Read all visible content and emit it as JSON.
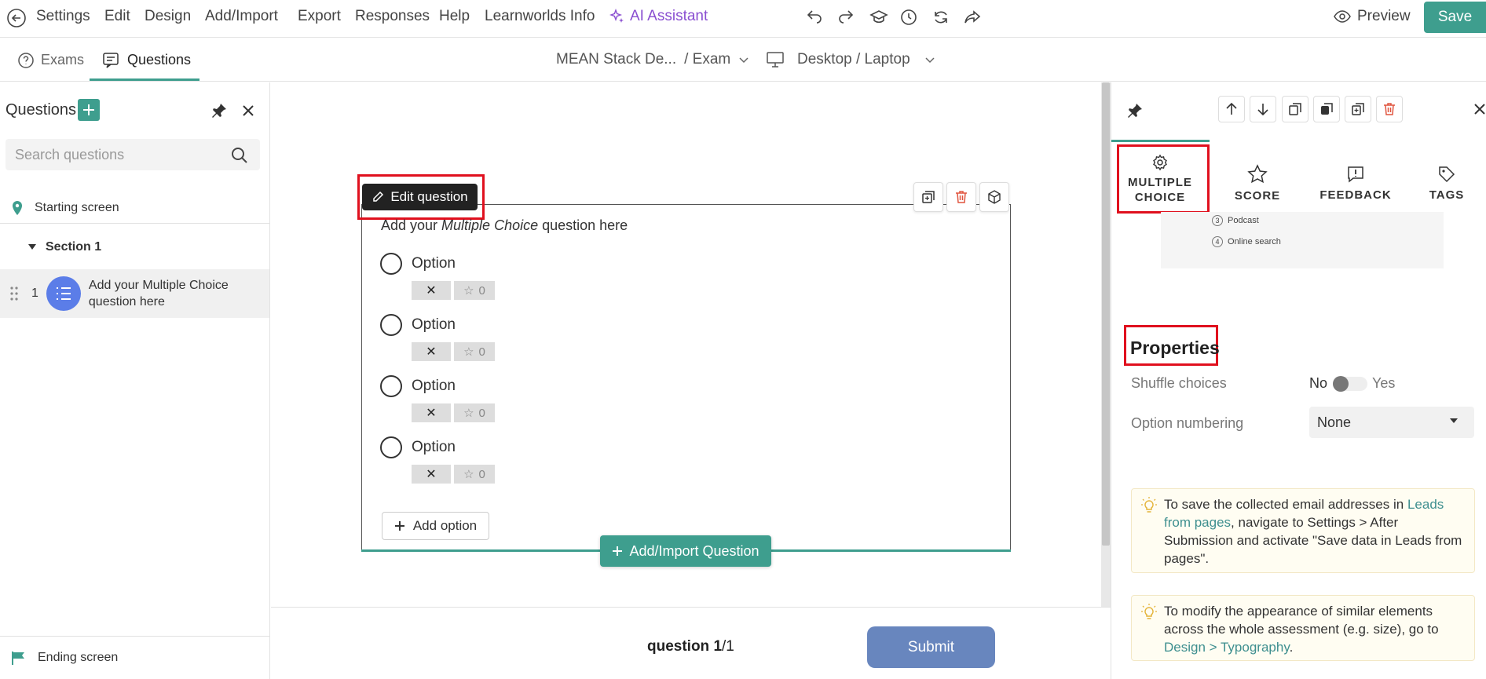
{
  "topbar": {
    "menu": [
      "Settings",
      "Edit",
      "Design",
      "Add/Import",
      "Export",
      "Responses",
      "Help",
      "Learnworlds Info"
    ],
    "ai_assistant": "AI Assistant",
    "preview_label": "Preview",
    "save_label": "Save"
  },
  "subbar": {
    "tab_exams": "Exams",
    "tab_questions": "Questions",
    "course_name": "MEAN Stack De...",
    "course_suffix": "/ Exam",
    "device": "Desktop / Laptop"
  },
  "left_panel": {
    "title": "Questions",
    "search_placeholder": "Search questions",
    "starting_screen": "Starting screen",
    "section": "Section 1",
    "question_number": "1",
    "question_title_line1": "Add your Multiple Choice",
    "question_title_line2": "question here",
    "ending_screen": "Ending screen"
  },
  "canvas": {
    "edit_question_label": "Edit question",
    "prompt_before": "Add your ",
    "prompt_italic": "Multiple Choice",
    "prompt_after": " question here",
    "options": [
      {
        "label": "Option",
        "score": "0"
      },
      {
        "label": "Option",
        "score": "0"
      },
      {
        "label": "Option",
        "score": "0"
      },
      {
        "label": "Option",
        "score": "0"
      }
    ],
    "add_option_label": "Add option",
    "add_import_label": "Add/Import Question"
  },
  "footer": {
    "question_word": "question",
    "current": "1",
    "total": "/1",
    "submit_label": "Submit"
  },
  "right_panel": {
    "tabs": {
      "multiple_choice_line1": "MULTIPLE",
      "multiple_choice_line2": "CHOICE",
      "score": "SCORE",
      "feedback": "FEEDBACK",
      "tags": "TAGS"
    },
    "preview_items": [
      {
        "num": "3",
        "label": "Podcast"
      },
      {
        "num": "4",
        "label": "Online search"
      }
    ],
    "properties_title": "Properties",
    "shuffle_label": "Shuffle choices",
    "shuffle_no": "No",
    "shuffle_yes": "Yes",
    "shuffle_value": false,
    "numbering_label": "Option numbering",
    "numbering_value": "None",
    "tip1": {
      "t1": "To save the collected email addresses in ",
      "link": "Leads from pages",
      "t2": ", navigate to Settings > After Submission and activate \"Save data in Leads from pages\"."
    },
    "tip2": {
      "t1": "To modify the appearance of similar elements across the whole assessment (e.g. size), go to ",
      "link": "Design > Typography",
      "t2": "."
    }
  },
  "colors": {
    "accent": "#3e9e8e",
    "submit": "#6886be",
    "ai": "#8a4fd1",
    "highlight_box": "#e0101e",
    "delete": "#e0533d"
  }
}
